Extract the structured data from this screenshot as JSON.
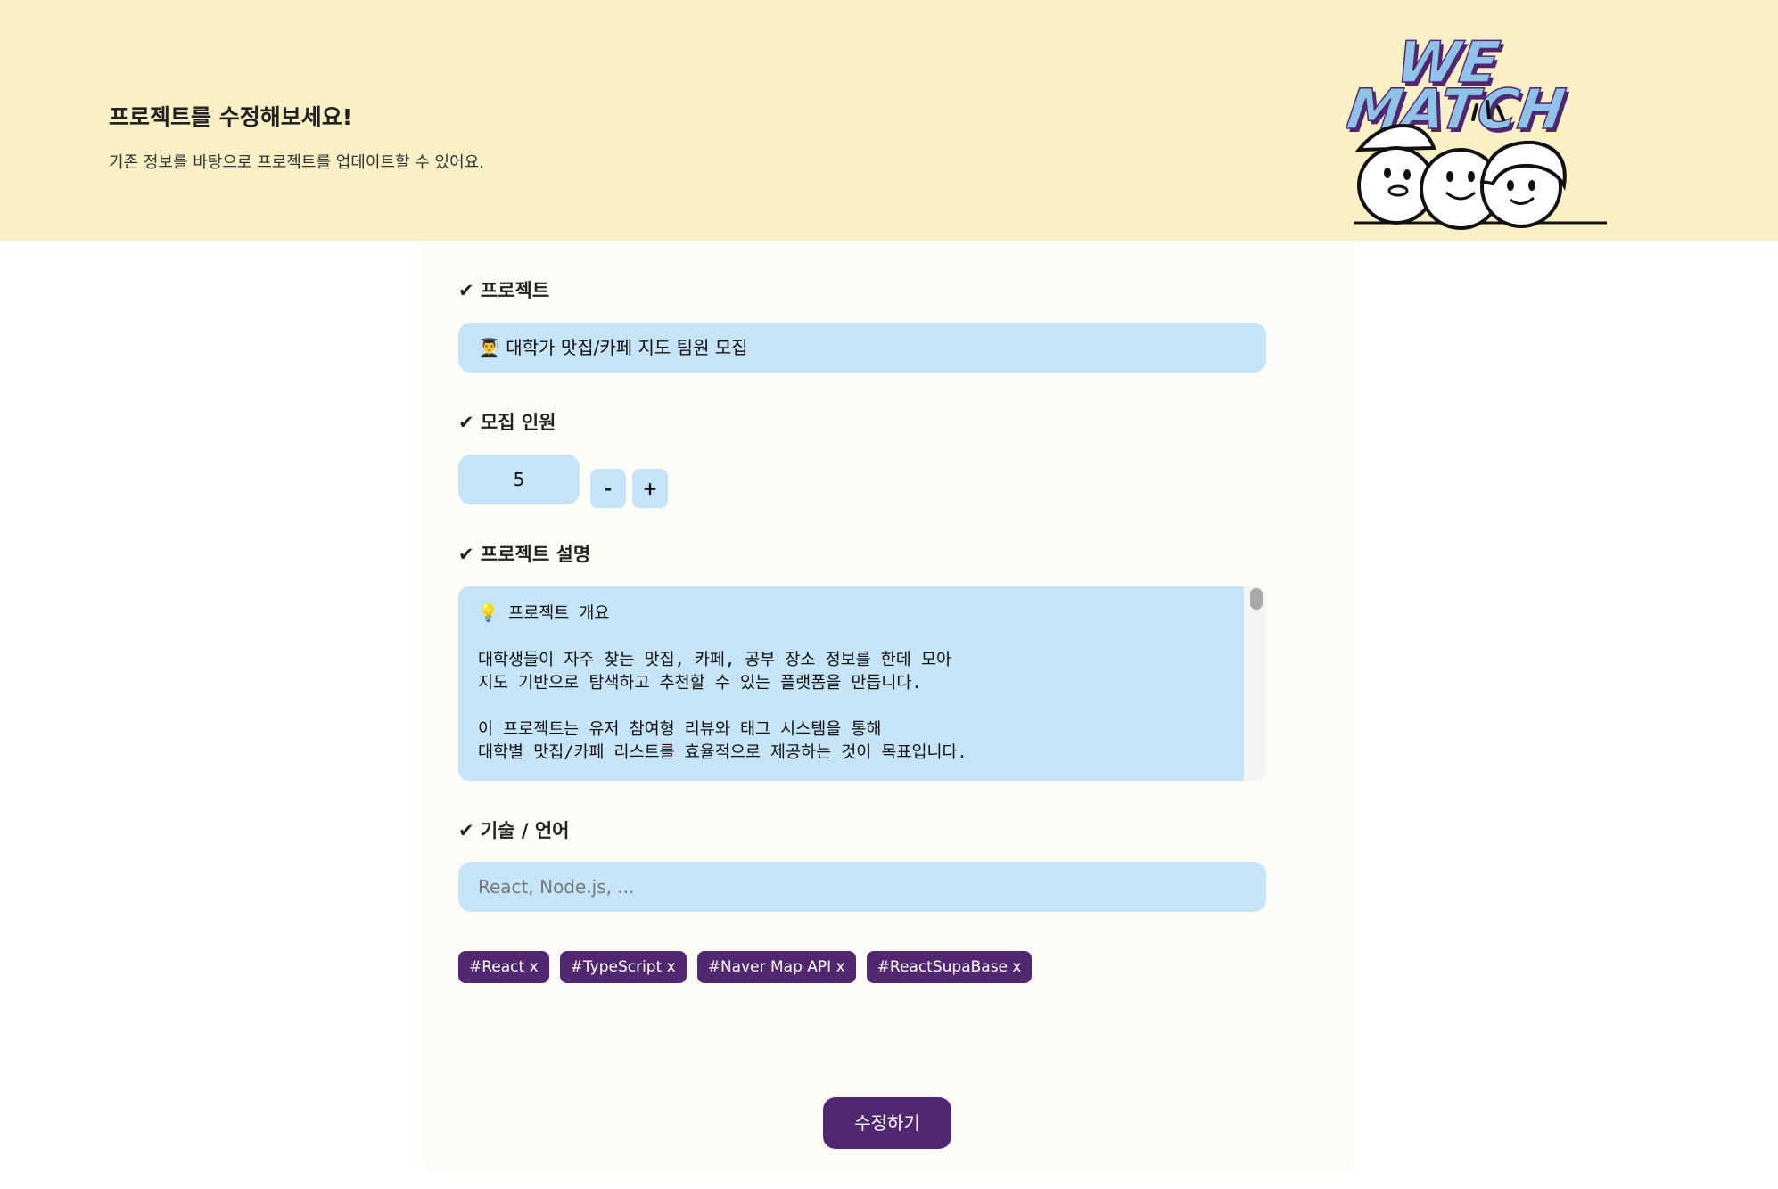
{
  "header": {
    "title": "프로젝트를 수정해보세요!",
    "subtitle": "기존 정보를 바탕으로 프로젝트를 업데이트할 수 있어요.",
    "logo_text": [
      "WE",
      "MATCH"
    ]
  },
  "form": {
    "project": {
      "label": "✔ 프로젝트",
      "value": "👨‍🎓 대학가 맛집/카페 지도 팀원 모집"
    },
    "recruit": {
      "label": "✔ 모집 인원",
      "count": "5",
      "minus_label": "-",
      "plus_label": "+"
    },
    "description": {
      "label": "✔ 프로젝트 설명",
      "text": "💡 프로젝트 개요\n\n대학생들이 자주 찾는 맛집, 카페, 공부 장소 정보를 한데 모아\n지도 기반으로 탐색하고 추천할 수 있는 플랫폼을 만듭니다.\n\n이 프로젝트는 유저 참여형 리뷰와 태그 시스템을 통해\n대학별 맛집/카페 리스트를 효율적으로 제공하는 것이 목표입니다."
    },
    "tech": {
      "label": "✔ 기술 / 언어",
      "placeholder": "React, Node.js, ...",
      "tags": [
        "#React x",
        "#TypeScript x",
        "#Naver Map API x",
        "#ReactSupaBase x"
      ]
    },
    "submit_label": "수정하기"
  },
  "colors": {
    "header_bg": "#faf0c6",
    "field_bg": "#c5e4f7",
    "accent": "#51276f"
  }
}
